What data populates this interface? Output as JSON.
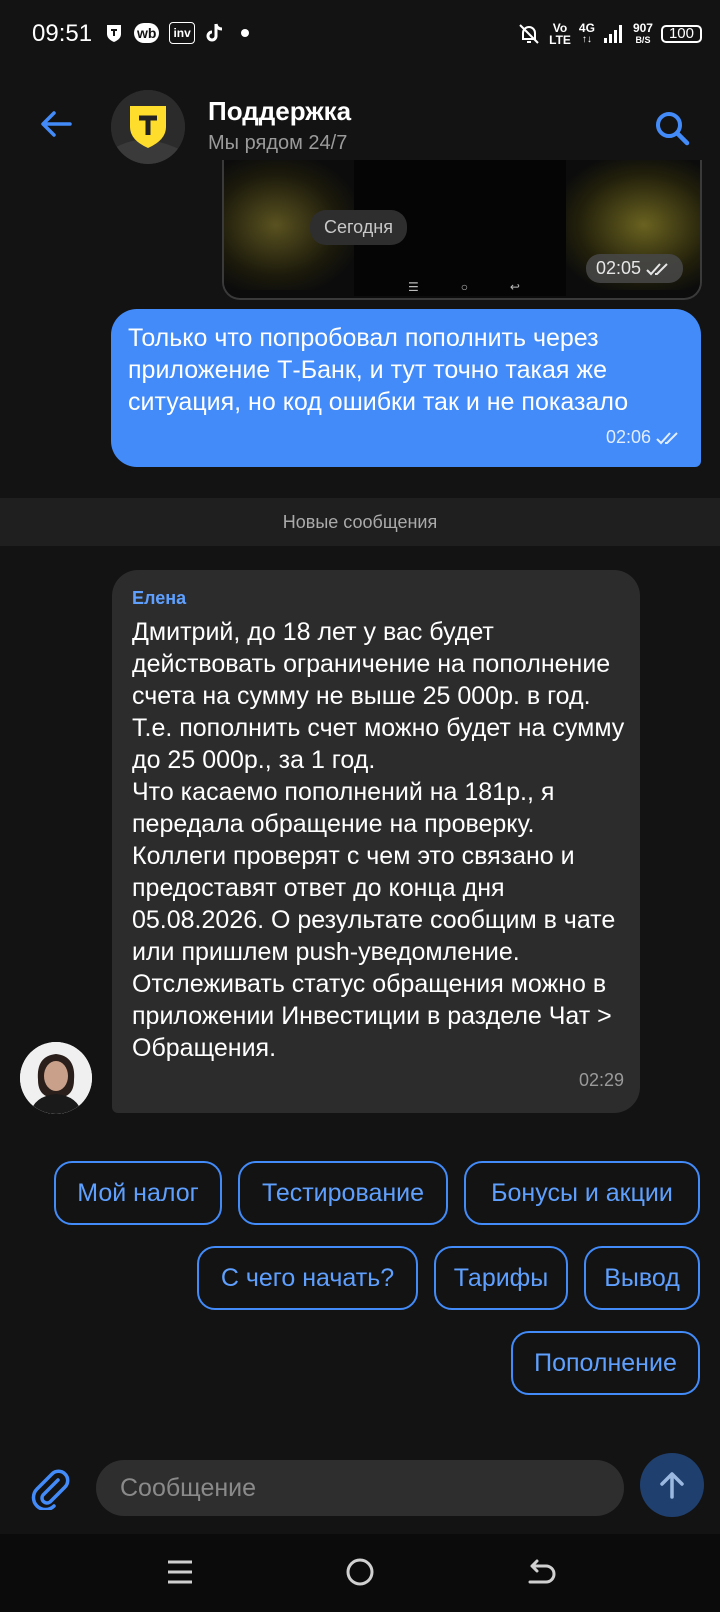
{
  "status_bar": {
    "time": "09:51",
    "left_icons": [
      "shield-app-icon",
      "wb",
      "inv",
      "tiktok-icon"
    ],
    "wb_label": "wb",
    "inv_label": "inv",
    "net_vo": "Vo",
    "net_lte": "LTE",
    "net_4g": "4G",
    "speed_value": "907",
    "speed_unit": "B/S",
    "battery": "100"
  },
  "header": {
    "title": "Поддержка",
    "subtitle": "Мы рядом 24/7",
    "logo_letter": "T"
  },
  "media_message": {
    "date_pill": "Сегодня",
    "time": "02:05"
  },
  "outgoing_message": {
    "text": "Только что попробовал пополнить через приложение Т-Банк, и тут точно такая же ситуация, но код ошибки так и не показало",
    "time": "02:06"
  },
  "divider": {
    "label": "Новые сообщения"
  },
  "incoming_message": {
    "sender": "Елена",
    "text": "Дмитрий, до 18 лет у вас будет действовать ограничение на пополнение счета на сумму не выше 25 000р. в год. Т.е. пополнить счет можно будет на сумму до 25 000р., за 1 год.\nЧто касаемо пополнений на 181р., я передала обращение на проверку. Коллеги проверят с чем это связано и предоставят ответ до конца дня 05.08.2026. О результате сообщим в чате или пришлем push-уведомление. Отслеживать статус обращения можно в приложении Инвестиции в разделе Чат > Обращения.",
    "time": "02:29"
  },
  "quick_replies": [
    "Мой налог",
    "Тестирование",
    "Бонусы и акции",
    "С чего начать?",
    "Тарифы",
    "Вывод",
    "Пополнение"
  ],
  "composer": {
    "placeholder": "Сообщение"
  },
  "colors": {
    "accent": "#428bf9",
    "background": "#131313",
    "incoming_bubble": "#2c2c2c",
    "brand_yellow": "#ffdd2d"
  }
}
